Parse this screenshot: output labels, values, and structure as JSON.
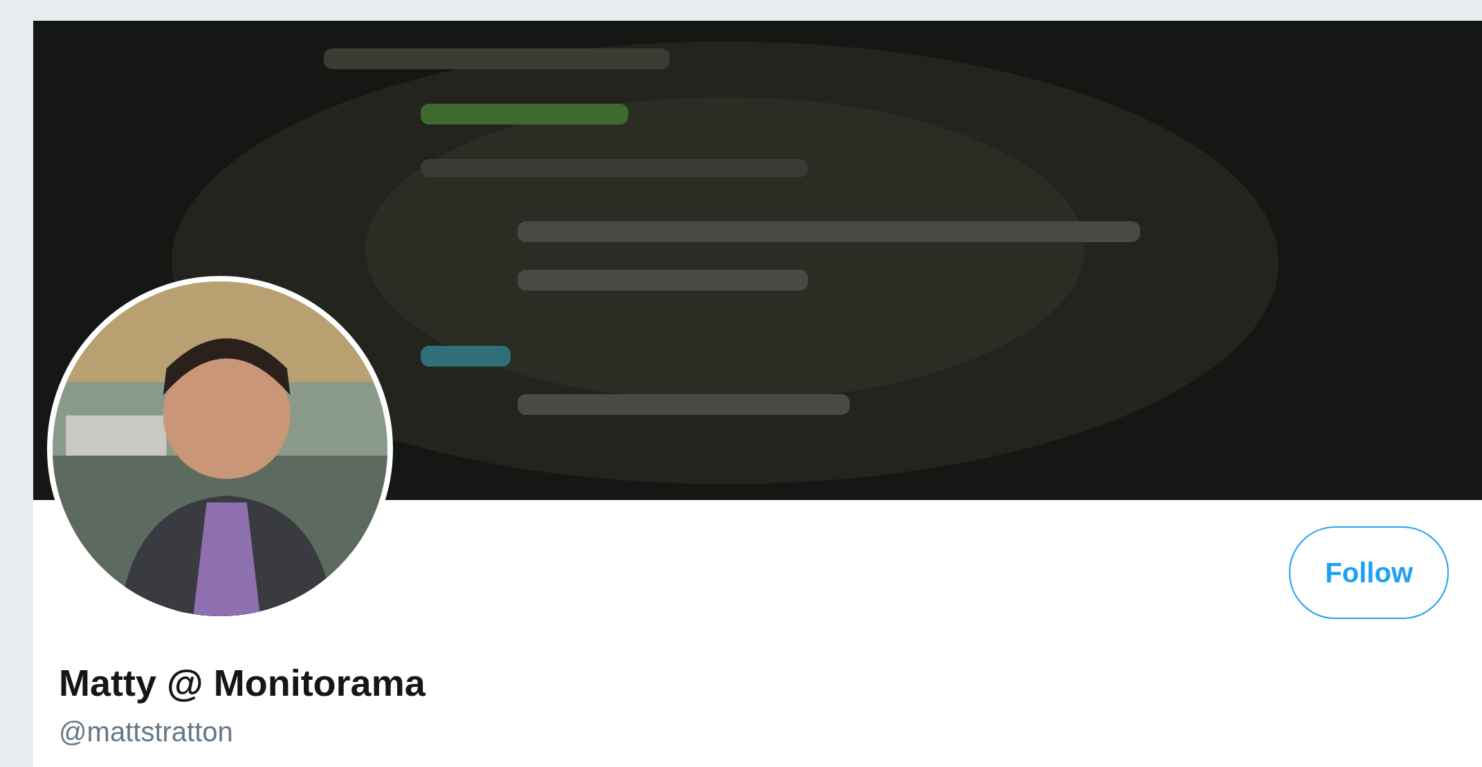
{
  "profile": {
    "follow_button": "Follow",
    "display_name": "Matty @ Monitorama",
    "handle": "@mattstratton"
  }
}
